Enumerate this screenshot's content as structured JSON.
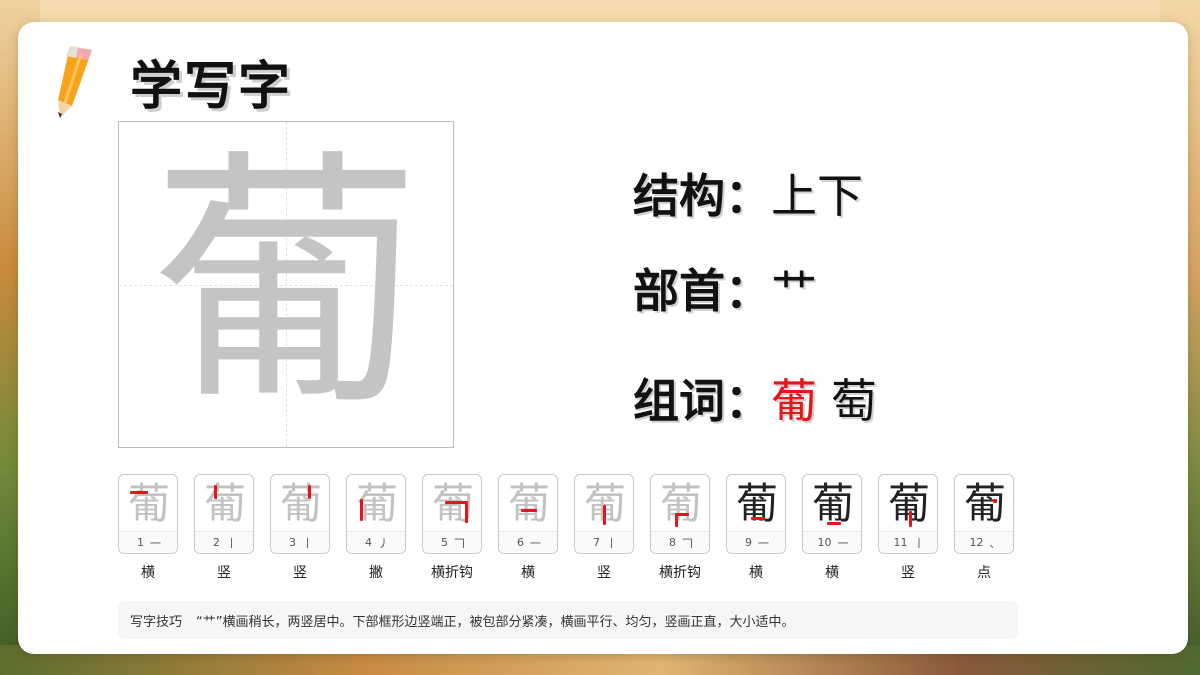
{
  "page": {
    "title": "学写字",
    "character": "葡",
    "icons": {
      "pencil": "pencil-icon"
    }
  },
  "info": {
    "structure_label": "结构：",
    "structure_value": "上下",
    "radical_label": "部首：",
    "radical_value": "艹",
    "words_label": "组词：",
    "word_highlight": "葡",
    "word_second": "萄"
  },
  "strokes": [
    {
      "glyph": "葡",
      "number": "1",
      "symbol": "一",
      "name": "横"
    },
    {
      "glyph": "葡",
      "number": "2",
      "symbol": "丨",
      "name": "竖"
    },
    {
      "glyph": "葡",
      "number": "3",
      "symbol": "丨",
      "name": "竖"
    },
    {
      "glyph": "葡",
      "number": "4",
      "symbol": "丿",
      "name": "撇"
    },
    {
      "glyph": "葡",
      "number": "5",
      "symbol": "𠃍",
      "name": "横折钩"
    },
    {
      "glyph": "葡",
      "number": "6",
      "symbol": "一",
      "name": "横"
    },
    {
      "glyph": "葡",
      "number": "7",
      "symbol": "丨",
      "name": "竖"
    },
    {
      "glyph": "葡",
      "number": "8",
      "symbol": "𠃍",
      "name": "横折钩"
    },
    {
      "glyph": "葡",
      "number": "9",
      "symbol": "一",
      "name": "横"
    },
    {
      "glyph": "葡",
      "number": "10",
      "symbol": "一",
      "name": "横"
    },
    {
      "glyph": "葡",
      "number": "11",
      "symbol": "丨",
      "name": "竖"
    },
    {
      "glyph": "葡",
      "number": "12",
      "symbol": "、",
      "name": "点"
    }
  ],
  "tip": {
    "label": "写字技巧",
    "text": "“艹”横画稍长，两竖居中。下部框形边竖端正，被包部分紧凑，横画平行、均匀，竖画正直，大小适中。"
  },
  "colors": {
    "accent_red": "#e8141c",
    "ghost_gray": "#c4c4c4",
    "text": "#111111"
  }
}
